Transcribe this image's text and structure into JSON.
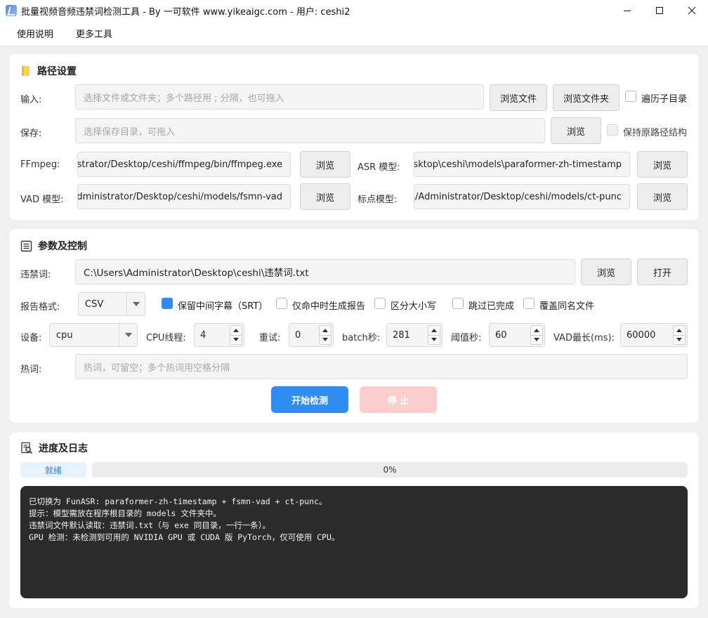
{
  "window": {
    "title": "批量视频音频违禁词检测工具 - By 一可软件 www.yikeaigc.com - 用户: ceshi2",
    "min_glyph": "—",
    "max_glyph": "☐",
    "close_glyph": "✕"
  },
  "menu": [
    "使用说明",
    "更多工具"
  ],
  "path_section": {
    "title": "路径设置",
    "input_label": "输入:",
    "input_placeholder": "选择文件或文件夹；多个路径用 ; 分隔，也可拖入",
    "browse_file": "浏览文件",
    "browse_folder": "浏览文件夹",
    "traverse_label": "遍历子目录",
    "traverse_checked": false,
    "save_label": "保存:",
    "save_placeholder": "选择保存目录，可拖入",
    "save_browse": "浏览",
    "keep_structure_label": "保持原路径结构",
    "ffmpeg_label": "FFmpeg:",
    "ffmpeg_value": "C:/Users/Administrator/Desktop/ceshi/ffmpeg/bin/ffmpeg.exe",
    "ffmpeg_browse": "浏览",
    "asr_label": "ASR 模型:",
    "asr_value": "C:\\Users\\Administrator\\Desktop\\ceshi\\models\\paraformer-zh-timestamp",
    "asr_browse": "浏览",
    "vad_label": "VAD 模型:",
    "vad_value": "C:/Users/Administrator/Desktop/ceshi/models/fsmn-vad",
    "vad_browse": "浏览",
    "punc_label": "标点模型:",
    "punc_value": "C:/Users/Administrator/Desktop/ceshi/models/ct-punc",
    "punc_browse": "浏览"
  },
  "param_section": {
    "title": "参数及控制",
    "banned_label": "违禁词:",
    "banned_value": "C:\\Users\\Administrator\\Desktop\\ceshi\\违禁词.txt",
    "banned_browse": "浏览",
    "banned_open": "打开",
    "report_label": "报告格式:",
    "report_value": "CSV",
    "keep_srt_label": "保留中间字幕（SRT）",
    "keep_srt_checked": true,
    "only_hit_label": "仅命中时生成报告",
    "case_label": "区分大小写",
    "skip_done_label": "跳过已完成",
    "overwrite_label": "覆盖同名文件",
    "device_label": "设备:",
    "device_value": "cpu",
    "cpu_threads_label": "CPU线程:",
    "cpu_threads_value": "4",
    "retry_label": "重试:",
    "retry_value": "0",
    "batch_label": "batch秒:",
    "batch_value": "281",
    "threshold_label": "阈值秒:",
    "threshold_value": "60",
    "vad_max_label": "VAD最长(ms):",
    "vad_max_value": "60000",
    "hotword_label": "热词:",
    "hotword_placeholder": "热词，可留空；多个热词用空格分隔",
    "start_label": "开始检测",
    "stop_label": "停 止"
  },
  "log_section": {
    "title": "进度及日志",
    "status": "就绪",
    "progress_text": "0%",
    "progress_value": 0,
    "lines": [
      "已切换为 FunASR: paraformer-zh-timestamp + fsmn-vad + ct-punc。",
      "提示：模型需放在程序根目录的 models 文件夹中。",
      "违禁词文件默认读取：违禁词.txt（与 exe 同目录，一行一条）。",
      "GPU 检测：未检测到可用的 NVIDIA GPU 或 CUDA 版 PyTorch，仅可使用 CPU。"
    ]
  },
  "colors": {
    "accent": "#2f8cf0",
    "stop_disabled": "#fbcdcd",
    "log_bg": "#2b2b2b"
  }
}
